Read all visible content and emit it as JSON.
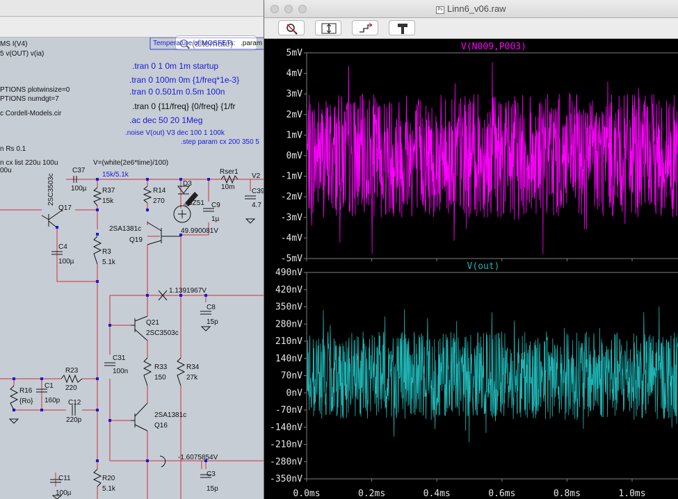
{
  "schematic": {
    "search_placeholder": "(alternate)",
    "spice_left": [
      "MS I(V4)",
      "5 v(OUT) v(ia)",
      "PTIONS plotwinsize=0",
      "PTIONS numdgt=7",
      "c Cordell-Models.cir",
      "n Rs 0.1",
      "n cx list 220u 100u",
      "00u"
    ],
    "mosfet_label": "Temperature of MOSFETs:",
    "param_label": ".param",
    "directives": [
      ".tran 0 1 0m 1m startup",
      ".tran 0 100m 0m {1/freq*1e-3}",
      ".tran 0 0.501m 0.5m 100n",
      ".tran 0 {11/freq} {0/freq} {1/fr",
      ".ac dec 50 20 1Meg",
      ".noise V(out) V3 dec 100 1 100k",
      ".step param cx 200 350 5"
    ],
    "source_expr": "V=(white(2e6*time)/100)",
    "ratio_label": "15k/5.1k",
    "node_v1": "49.990081V",
    "node_v2": "1.1391967V",
    "node_v3": "-1.6075854V",
    "parts": {
      "C37": "C37",
      "C37v": "100µ",
      "R37": "R37",
      "R37v": "15k",
      "R14": "R14",
      "R14v": "270",
      "D3": "D3",
      "BZ": "BZ51",
      "C9": "C9",
      "C9v": "1µ",
      "Rser": "Rser1",
      "Rserv": "10m",
      "V2": "V2",
      "C39": "C39",
      "C39v": "4.7",
      "Q17": "Q17",
      "Q17t": "2SC3503c",
      "C4": "C4",
      "C4v": "100µ",
      "R3": "R3",
      "R3v": "5.1k",
      "Q19": "Q19",
      "Q19t": "2SA1381c",
      "C8": "C8",
      "C8v": "15p",
      "Q21": "Q21",
      "Q21t": "2SC3503c",
      "C31": "C31",
      "C31v": "100n",
      "R33": "R33",
      "R33v": "150",
      "R34": "R34",
      "R34v": "27k",
      "R23": "R23",
      "R23v": "220",
      "R16": "R16",
      "R16v": "{Ro}",
      "C1": "C1",
      "C1v": "160p",
      "C12": "C12",
      "C12v": "220p",
      "Q16": "Q16",
      "Q16t": "2SA1381c",
      "C3": "C3",
      "C3v": "15p",
      "C11": "C11",
      "C11v": "100µ",
      "R20": "R20",
      "R20v": "5.1k"
    }
  },
  "waveform": {
    "window_title": "Linn6_v06.raw",
    "toolbar": [
      "zoom-out-icon",
      "autorange-icon",
      "pan-icon",
      "probe-icon"
    ],
    "colors": {
      "top": "#ff00ff",
      "bottom": "#1fb3b3",
      "grid": "#808080"
    },
    "top_pane": {
      "trace": "V(N009,P003)",
      "y_ticks": [
        "5mV",
        "4mV",
        "3mV",
        "2mV",
        "1mV",
        "0mV",
        "-1mV",
        "-2mV",
        "-3mV",
        "-4mV",
        "-5mV"
      ]
    },
    "bottom_pane": {
      "trace": "V(out)",
      "y_ticks": [
        "490nV",
        "420nV",
        "350nV",
        "280nV",
        "210nV",
        "140nV",
        "70nV",
        "0nV",
        "-70nV",
        "-140nV",
        "-210nV",
        "-280nV",
        "-350nV"
      ]
    },
    "x_ticks": [
      "0.0ms",
      "0.2ms",
      "0.4ms",
      "0.6ms",
      "0.8ms",
      "1.0ms"
    ]
  },
  "chart_data": [
    {
      "type": "line",
      "title": "V(N009,P003)",
      "x_range_ms": [
        0.0,
        1.1
      ],
      "ylim_mV": [
        -5,
        5
      ],
      "description_of_signal": "white noise approx ±4.5mV",
      "series": [
        {
          "name": "V(N009,P003)",
          "color": "#ff00ff"
        }
      ]
    },
    {
      "type": "line",
      "title": "V(out)",
      "x_range_ms": [
        0.0,
        1.1
      ],
      "ylim_nV": [
        -350,
        490
      ],
      "series": [
        {
          "name": "V(out)",
          "color": "#1fb3b3"
        }
      ]
    }
  ]
}
